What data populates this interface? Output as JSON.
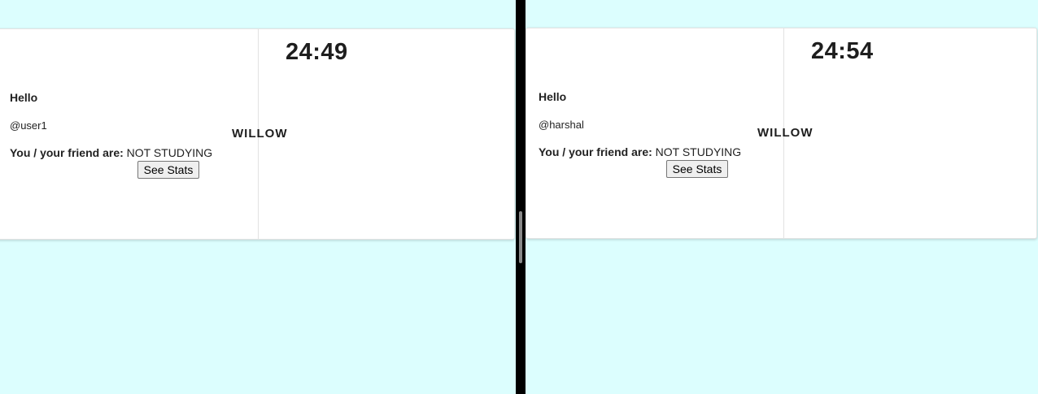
{
  "panes": [
    {
      "timer": "24:49",
      "brand": "WILLOW",
      "greeting": "Hello",
      "handle": "@user1",
      "status_label": "You / your friend are:",
      "status_value": "NOT STUDYING",
      "stats_button": "See Stats"
    },
    {
      "timer": "24:54",
      "brand": "WILLOW",
      "greeting": "Hello",
      "handle": "@harshal",
      "status_label": "You / your friend are:",
      "status_value": "NOT STUDYING",
      "stats_button": "See Stats"
    }
  ],
  "colors": {
    "background": "#dcfefe",
    "divider": "#000000",
    "card": "#ffffff"
  }
}
